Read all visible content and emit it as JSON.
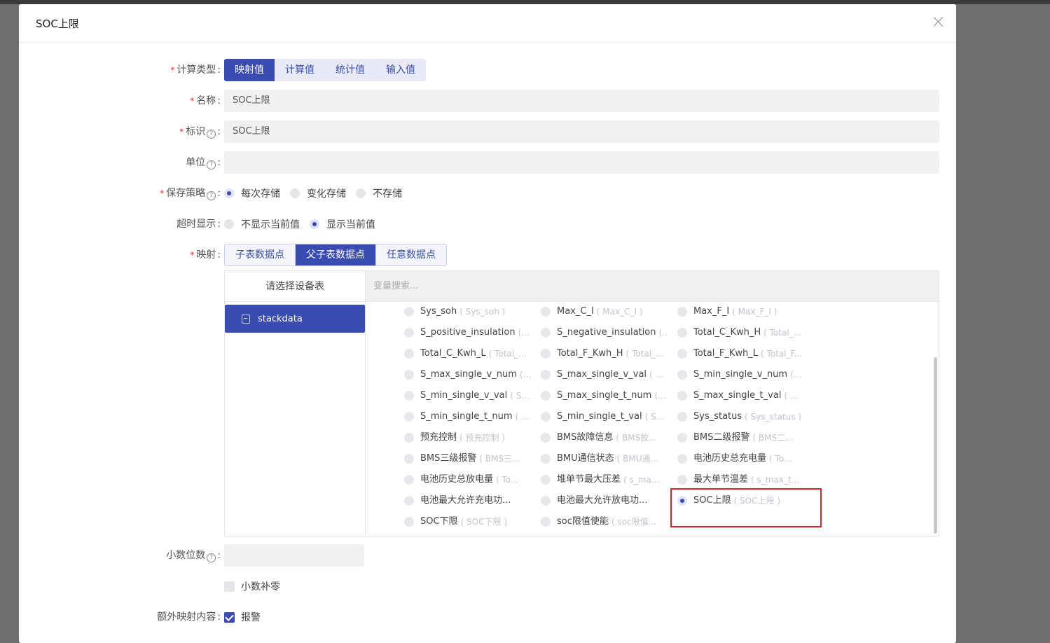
{
  "dialog": {
    "title": "SOC上限"
  },
  "form": {
    "calc_type": {
      "label": "计算类型",
      "options": [
        "映射值",
        "计算值",
        "统计值",
        "输入值"
      ],
      "selected": "映射值"
    },
    "name": {
      "label": "名称",
      "value": "SOC上限"
    },
    "identifier": {
      "label": "标识",
      "value": "SOC上限"
    },
    "unit": {
      "label": "单位",
      "value": ""
    },
    "save_policy": {
      "label": "保存策略",
      "options": [
        "每次存储",
        "变化存储",
        "不存储"
      ],
      "selected": "每次存储"
    },
    "timeout_display": {
      "label": "超时显示",
      "options": [
        "不显示当前值",
        "显示当前值"
      ],
      "selected": "显示当前值"
    },
    "mapping": {
      "label": "映射",
      "tabs": [
        "子表数据点",
        "父子表数据点",
        "任意数据点"
      ],
      "selected": "父子表数据点"
    },
    "decimals": {
      "label": "小数位数",
      "value": ""
    },
    "zero_pad": {
      "label": "小数补零",
      "checked": false
    },
    "extra_mapping": {
      "label": "额外映射内容",
      "option": "报警",
      "checked": true
    }
  },
  "picker": {
    "left_header": "请选择设备表",
    "tables": [
      "stackdata"
    ],
    "search_placeholder": "变量搜索...",
    "variables": [
      {
        "name": "Sys_soh",
        "alias": "( Sys_soh )"
      },
      {
        "name": "Max_C_I",
        "alias": "( Max_C_I )"
      },
      {
        "name": "Max_F_I",
        "alias": "( Max_F_I )"
      },
      {
        "name": "S_positive_insulation",
        "alias": "( ..."
      },
      {
        "name": "S_negative_insulation",
        "alias": "(..."
      },
      {
        "name": "Total_C_Kwh_H",
        "alias": "( Total_..."
      },
      {
        "name": "Total_C_Kwh_L",
        "alias": "( Total_C..."
      },
      {
        "name": "Total_F_Kwh_H",
        "alias": "( Total_F..."
      },
      {
        "name": "Total_F_Kwh_L",
        "alias": "( Total_F..."
      },
      {
        "name": "S_max_single_v_num",
        "alias": "( ..."
      },
      {
        "name": "S_max_single_v_val",
        "alias": "( S..."
      },
      {
        "name": "S_min_single_v_num",
        "alias": "( ..."
      },
      {
        "name": "S_min_single_v_val",
        "alias": "( S_..."
      },
      {
        "name": "S_max_single_t_num",
        "alias": "( ..."
      },
      {
        "name": "S_max_single_t_val",
        "alias": "( S_..."
      },
      {
        "name": "S_min_single_t_num",
        "alias": "( ..."
      },
      {
        "name": "S_min_single_t_val",
        "alias": "( S_..."
      },
      {
        "name": "Sys_status",
        "alias": "( Sys_status )"
      },
      {
        "name": "预充控制",
        "alias": "( 预充控制 )"
      },
      {
        "name": "BMS故障信息",
        "alias": "( BMS故..."
      },
      {
        "name": "BMS二级报警",
        "alias": "( BMS二..."
      },
      {
        "name": "BMS三级报警",
        "alias": "( BMS三..."
      },
      {
        "name": "BMU通信状态",
        "alias": "( BMU通..."
      },
      {
        "name": "电池历史总充电量",
        "alias": "( To..."
      },
      {
        "name": "电池历史总放电量",
        "alias": "( To..."
      },
      {
        "name": "堆单节最大压差",
        "alias": "( s_ma..."
      },
      {
        "name": "最大单节温差",
        "alias": "( s_max_t..."
      },
      {
        "name": "电池最大允许充电功...",
        "alias": ""
      },
      {
        "name": "电池最大允许放电功...",
        "alias": ""
      },
      {
        "name": "SOC上限",
        "alias": "( SOC上限 )"
      },
      {
        "name": "SOC下限",
        "alias": "( SOC下限 )"
      },
      {
        "name": "soc限值使能",
        "alias": "( soc限值..."
      }
    ],
    "selected": "SOC上限"
  },
  "colors": {
    "primary": "#3b4cb0",
    "highlight": "#d9232d"
  }
}
